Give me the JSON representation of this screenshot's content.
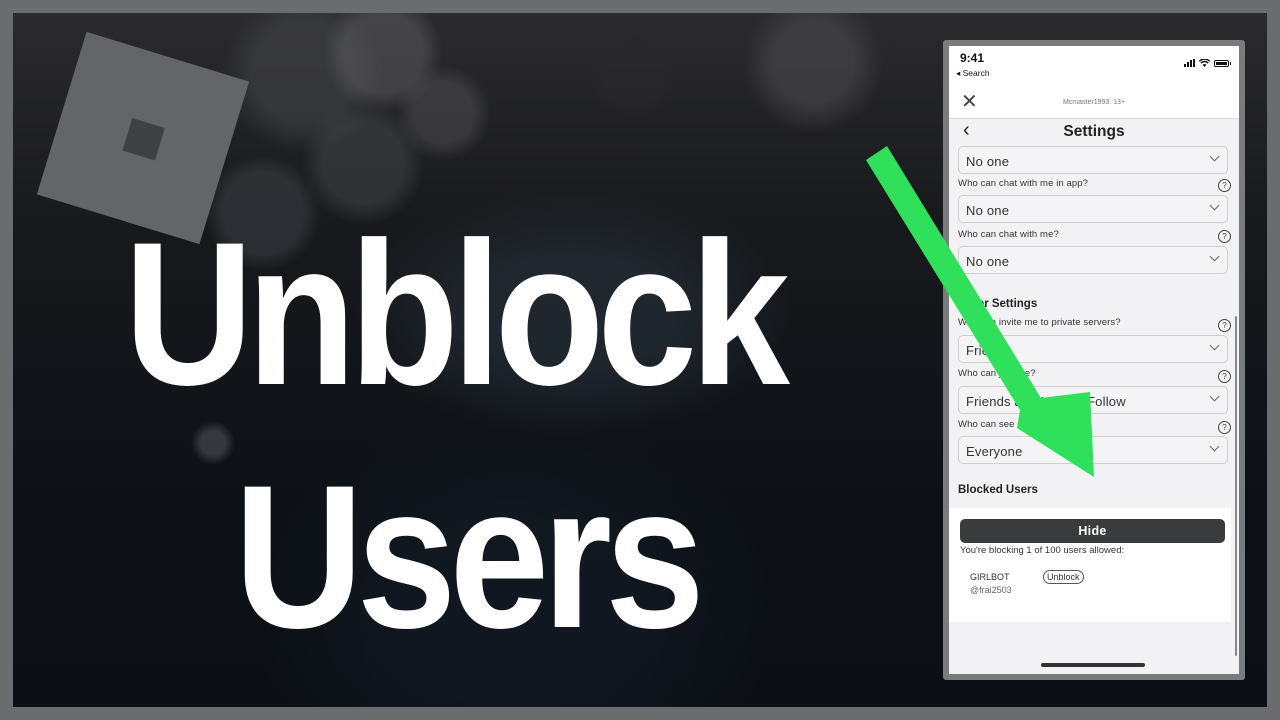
{
  "thumbnail": {
    "headline_line1": "Unblock",
    "headline_line2": "Users",
    "accent_color": "#2ee05a",
    "logo": "roblox-logo-icon"
  },
  "phone": {
    "status_bar": {
      "time": "9:41",
      "back_label": "◂ Search",
      "icons": [
        "signal-icon",
        "wifi-icon",
        "battery-icon"
      ]
    },
    "top_bar": {
      "close_icon": "✕",
      "account_label": "Mcmaster1993: 13+"
    },
    "header": {
      "back_icon": "‹",
      "title": "Settings"
    },
    "settings": [
      {
        "label": "",
        "value": "No one"
      },
      {
        "label": "Who can chat with me in app?",
        "value": "No one"
      },
      {
        "label": "Who can chat with me?",
        "value": "No one"
      }
    ],
    "other_settings": {
      "section_title": "Other Settings",
      "items": [
        {
          "label": "Who can invite me to private servers?",
          "value": "Friends"
        },
        {
          "label": "Who can join me?",
          "value": "Friends and Users I Follow"
        },
        {
          "label": "Who can see my inventory?",
          "value": "Everyone"
        }
      ]
    },
    "blocked_users": {
      "section_title": "Blocked Users",
      "hide_label": "Hide",
      "blocking_text": "You're blocking 1 of 100 users allowed:",
      "users": [
        {
          "display_name": "GIRLBOT",
          "handle": "@frai2503",
          "action_label": "Unblock"
        }
      ]
    },
    "help_glyph": "?"
  }
}
